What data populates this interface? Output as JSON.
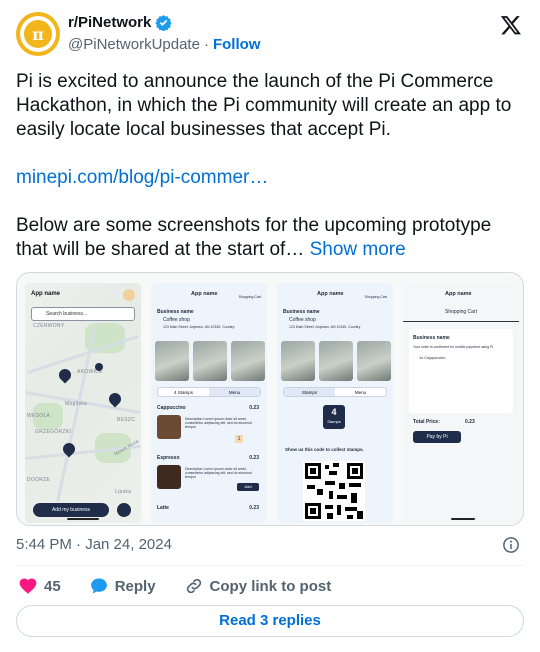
{
  "author": {
    "display_name": "r/PiNetwork",
    "handle": "@PiNetworkUpdate",
    "separator": "·",
    "follow_label": "Follow"
  },
  "tweet": {
    "paragraph_1": "Pi is excited to announce the launch of the Pi Commerce Hackathon, in which the Pi community will create an app to easily locate local businesses that accept Pi.",
    "link_text": "minepi.com/blog/pi-commer…",
    "paragraph_3": "Below are some screenshots for the upcoming prototype that will be shared at the start of…",
    "show_more": "Show more"
  },
  "media": {
    "screen_1": {
      "app_name": "App name",
      "search_placeholder": "Search business...",
      "add_button": "Add my business",
      "map_labels": [
        "CZERWONY",
        "AKOWICE",
        "WESOŁA",
        "GRZEGÓRZKI",
        "BESZC",
        "Nowa Huta",
        "DOORZE",
        "Lipska",
        "Mogilska"
      ]
    },
    "screen_2": {
      "app_name": "App name",
      "cart_label": "Shopping Cart",
      "business_name": "Business name",
      "category": "Coffee shop",
      "address": "123 Main Street, Anytown, AN 12345, Country",
      "tab_stamps": "4 Stamps",
      "tab_menu": "Menu",
      "items": [
        {
          "name": "Cappuccino",
          "price": "0.23",
          "desc": "Description Lorem ipsum dolor sit amet, consectetur adipiscing elit, sed do eiusmod tempor"
        },
        {
          "name": "Espresso",
          "price": "0.23",
          "desc": "Description Lorem ipsum dolor sit amet, consectetur adipiscing elit, sed do eiusmod tempor",
          "action": "Add"
        },
        {
          "name": "Latte",
          "price": "0.23",
          "desc": ""
        }
      ],
      "qty": "1"
    },
    "screen_3": {
      "app_name": "App name",
      "cart_label": "Shopping Cart",
      "business_name": "Business name",
      "category": "Coffee shop",
      "address": "123 Main Street, Anytown, AN 12345, Country",
      "tab_stamps": "Stamps",
      "tab_menu": "Menu",
      "stamp_count": "4",
      "stamp_word": "Stamps",
      "collect_text": "Show us this code to collect stamps."
    },
    "screen_4": {
      "app_name": "App name",
      "title": "Shopping Cart",
      "business_name": "Business name",
      "note": "Your order is confirmed for mobile payment using Pi",
      "line_item": "1x Cappuccino",
      "total_label": "Total Price:",
      "total_value": "0.23",
      "pay_button": "Pay by Pi"
    }
  },
  "meta": {
    "timestamp": "5:44 PM · Jan 24, 2024"
  },
  "actions": {
    "like_count": "45",
    "reply_label": "Reply",
    "copy_label": "Copy link to post",
    "read_replies": "Read 3 replies"
  },
  "colors": {
    "link": "#006fd6",
    "like": "#f91880",
    "reply": "#1d9bf0",
    "verified": "#1d9bf0",
    "pi_gold": "#f2b51c"
  }
}
